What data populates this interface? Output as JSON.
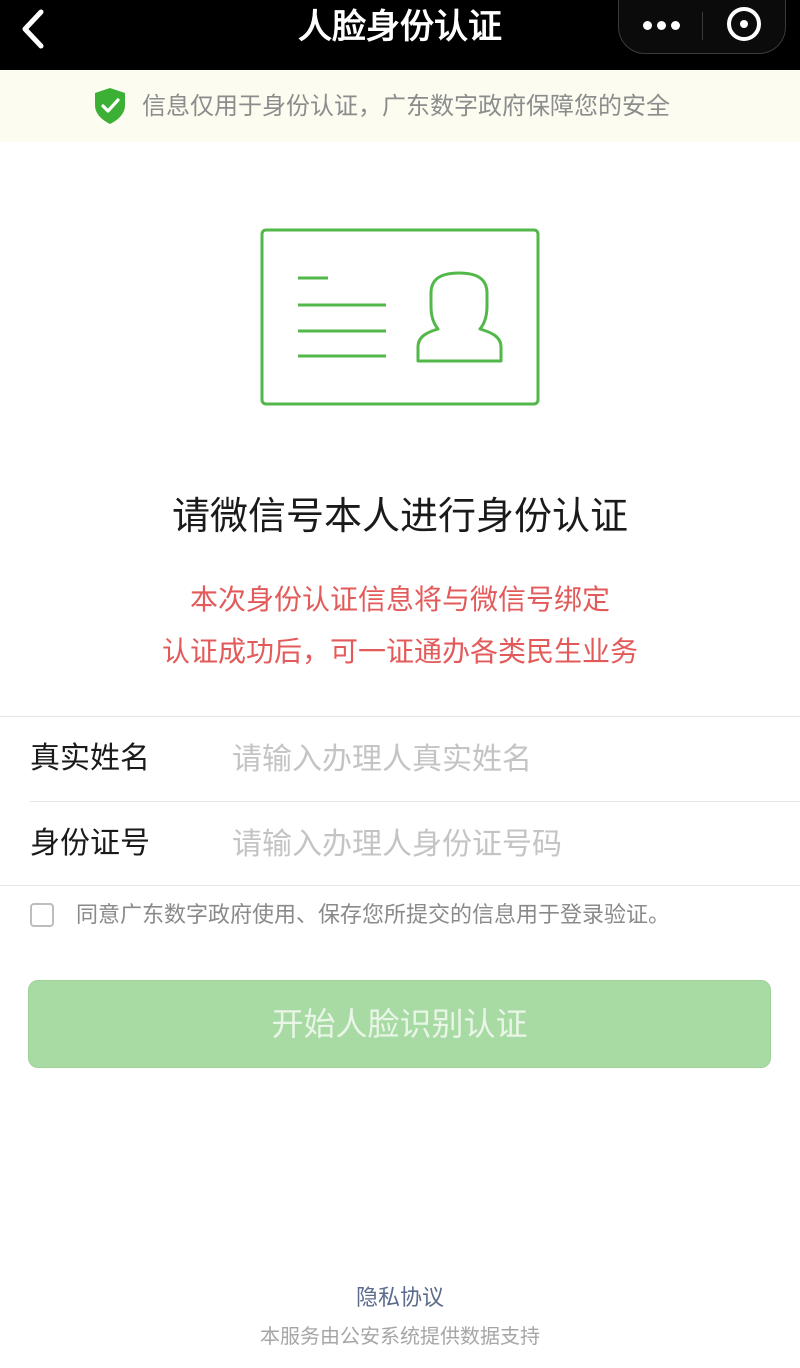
{
  "header": {
    "title": "人脸身份认证",
    "back_icon": "chevron-left-icon",
    "more_icon": "more-dots-icon",
    "close_icon": "target-circle-icon"
  },
  "notice": {
    "icon": "shield-check-icon",
    "text": "信息仅用于身份认证，广东数字政府保障您的安全",
    "icon_color": "#3cb035"
  },
  "illustration": {
    "icon": "id-card-icon",
    "color": "#52b84a"
  },
  "main": {
    "heading": "请微信号本人进行身份认证",
    "subtitle_line1": "本次身份认证信息将与微信号绑定",
    "subtitle_line2": "认证成功后，可一证通办各类民生业务",
    "subtitle_color": "#e35a5a"
  },
  "form": {
    "name_label": "真实姓名",
    "name_placeholder": "请输入办理人真实姓名",
    "name_value": "",
    "id_label": "身份证号",
    "id_placeholder": "请输入办理人身份证号码",
    "id_value": ""
  },
  "agreement": {
    "checked": false,
    "text": "同意广东数字政府使用、保存您所提交的信息用于登录验证。"
  },
  "actions": {
    "start_label": "开始人脸识别认证",
    "button_color": "#a8daa4"
  },
  "footer": {
    "privacy_link": "隐私协议",
    "note": "本服务由公安系统提供数据支持"
  }
}
